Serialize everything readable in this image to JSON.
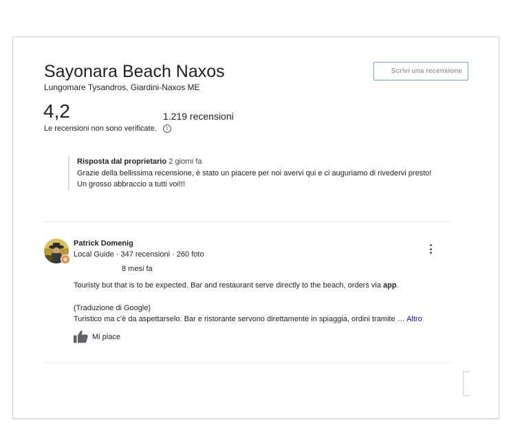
{
  "place": {
    "title": "Sayonara Beach Naxos",
    "address": "Lungomare Tysandros, Giardini-Naxos ME"
  },
  "actions": {
    "write_review_label": "Scrivi una recensione"
  },
  "summary": {
    "rating": "4,2",
    "review_count": "1.219 recensioni",
    "unverified_note": "Le recensioni non sono verificate.",
    "info_icon": "info-icon"
  },
  "owner_reply": {
    "heading": "Risposta dal proprietario",
    "when": "2 giorni fa",
    "line1": "Grazie della bellissima recensione, è stato un piacere per noi avervi qui e ci auguriamo di rivedervi presto!",
    "line2": "Un grosso abbraccio a tutti voi!!!"
  },
  "review": {
    "reviewer_name": "Patrick Domenig",
    "reviewer_meta": "Local Guide · 347 recensioni · 260 foto",
    "date": "8 mesi fa",
    "text_before_bold": "Touristy but that is to be expected. Bar and restaurant serve directly to the beach, orders via ",
    "text_bold": "app",
    "text_after_bold": ".",
    "translation_note": "(Traduzione di Google)",
    "translated_text": "Turistico ma c'è da aspettarselo. Bar e ristorante servono direttamente in spiaggia, ordini tramite … ",
    "more_link": "Altro",
    "like_label": "Mi piace",
    "like_icon": "thumbs-up-icon",
    "menu_icon": "more-vert-icon",
    "badge_icon": "local-guide-star-icon"
  },
  "colors": {
    "link": "#1a0dab",
    "button_border": "#6d9eeb",
    "badge": "#f08a4b"
  }
}
